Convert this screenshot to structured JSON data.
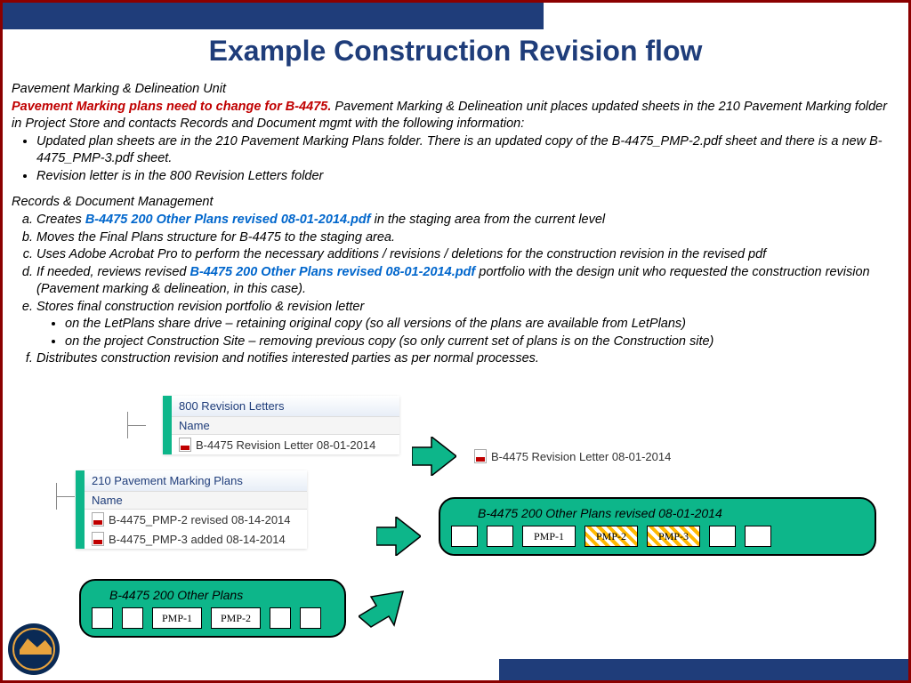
{
  "title": "Example Construction Revision flow",
  "section1_head": "Pavement Marking & Delineation Unit",
  "red_lead": "Pavement Marking plans need to change for B-4475.",
  "section1_tail": "  Pavement Marking & Delineation unit places updated sheets in the 210 Pavement Marking folder in Project Store and contacts Records and Document mgmt with the following information:",
  "bullet1": "Updated plan sheets are in the 210 Pavement Marking Plans folder. There is an updated copy of the B-4475_PMP-2.pdf sheet and there is a new B-4475_PMP-3.pdf sheet.",
  "bullet2": "Revision letter is in the 800 Revision Letters folder",
  "section2_head": "Records & Document Management",
  "step_a_pre": "Creates ",
  "pdf_name_1": "B-4475 200 Other Plans revised 08-01-2014.pdf",
  "step_a_post": " in the staging area from the current level",
  "step_b": "Moves the Final Plans structure for B-4475 to the staging area.",
  "step_c": "Uses Adobe Acrobat Pro to perform the necessary additions / revisions / deletions for the construction revision in the revised pdf",
  "step_d_pre": "If needed, reviews revised ",
  "step_d_post": " portfolio with the design unit who requested the construction revision (Pavement marking & delineation, in this case).",
  "step_e": "Stores final construction revision portfolio & revision letter",
  "sub_e1": "on the LetPlans share drive – retaining original copy (so all versions of the plans are available from LetPlans)",
  "sub_e2": "on the project Construction Site – removing previous copy (so only current set of plans is on the Construction site)",
  "step_f": "Distributes construction revision and notifies interested parties as per normal processes.",
  "folder1_title": "800 Revision Letters",
  "name_col": "Name",
  "folder1_file": "B-4475 Revision Letter 08-01-2014",
  "folder2_title": "210 Pavement Marking Plans",
  "folder2_file1": "B-4475_PMP-2 revised 08-14-2014",
  "folder2_file2": "B-4475_PMP-3 added 08-14-2014",
  "float_file": "B-4475 Revision Letter 08-01-2014",
  "pill_big_label": "B-4475  200 Other Plans revised  08-01-2014",
  "pill_small_label": "B-4475 200 Other Plans",
  "pmp1": "PMP-1",
  "pmp2": "PMP-2",
  "pmp3": "PMP-3"
}
